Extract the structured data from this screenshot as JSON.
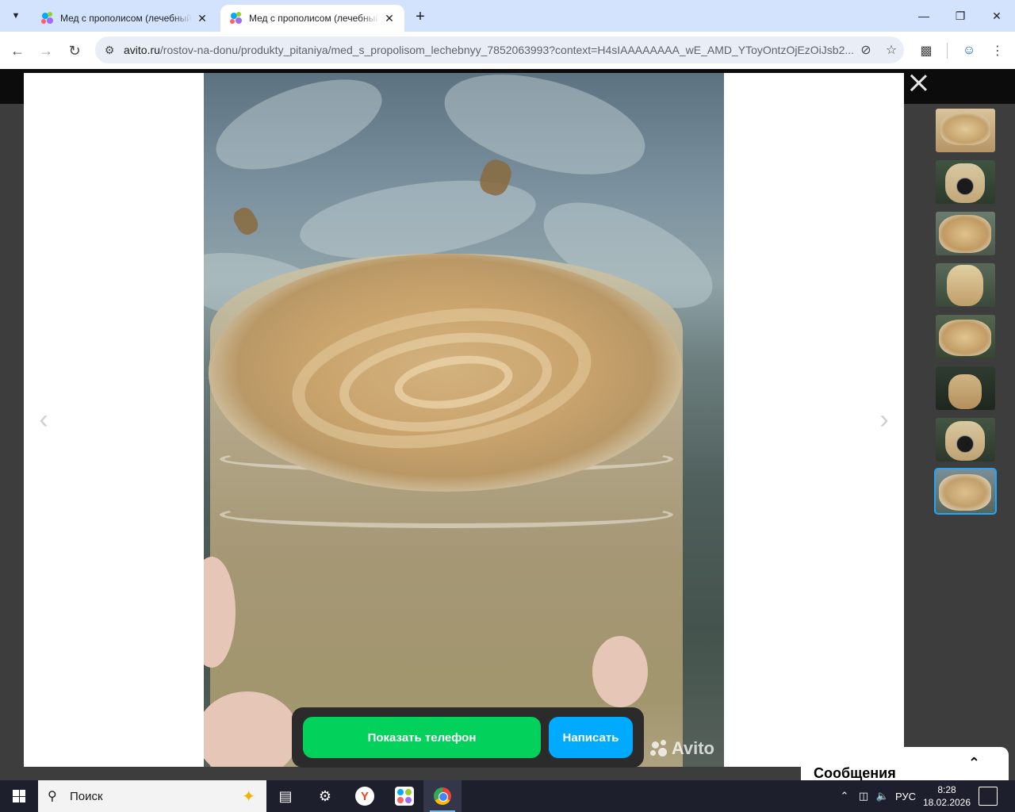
{
  "browser": {
    "tabs": [
      {
        "title": "Мед с прополисом (лечебный) в Ростове-на-Дону",
        "active": false
      },
      {
        "title": "Мед с прополисом (лечебный) в Ростове-на-Дону",
        "active": true
      }
    ],
    "url_domain": "avito.ru",
    "url_path": "/rostov-na-donu/produkty_pitaniya/med_s_propolisom_lechebnyy_7852063993?context=H4sIAAAAAAAA_wE_AMD_YToyOntzOjEzOiJsb2...",
    "icons": {
      "tab_menu": "chevron-down-icon",
      "new_tab": "plus-icon",
      "back": "arrow-left-icon",
      "forward": "arrow-right-icon",
      "reload": "reload-icon",
      "site_info": "tune-icon",
      "eye_off": "eye-off-icon",
      "bookmark": "star-icon",
      "extensions": "puzzle-icon",
      "profile": "profile-icon",
      "menu": "kebab-icon"
    }
  },
  "gallery": {
    "watermark": "Avito",
    "thumbnail_count": 8,
    "selected_thumbnail": 8,
    "buttons": {
      "show_phone": "Показать телефон",
      "write": "Написать"
    },
    "colors": {
      "show_phone": "#02d15c",
      "write": "#00aaff",
      "selected_outline": "#1ea7fd"
    }
  },
  "page": {
    "messages_label": "Сообщения"
  },
  "taskbar": {
    "search_placeholder": "Поиск",
    "language": "РУС",
    "time": "8:28",
    "date": "18.02.2026"
  }
}
